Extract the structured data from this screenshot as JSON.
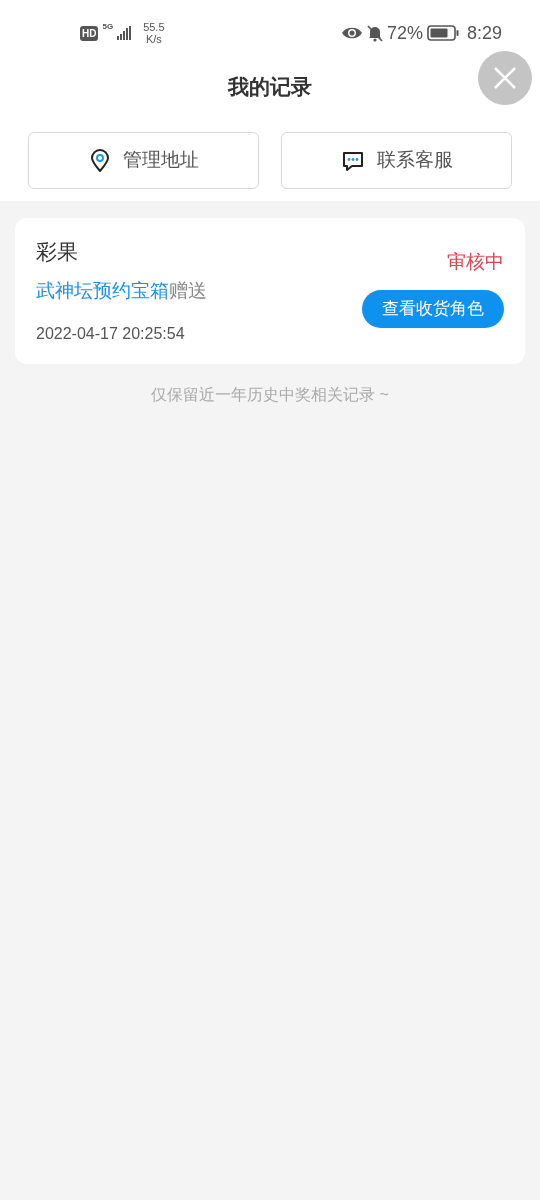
{
  "status_bar": {
    "hd": "HD",
    "network": "5G",
    "speed": "55.5",
    "speed_unit": "K/s",
    "battery": "72%",
    "time": "8:29"
  },
  "header": {
    "title": "我的记录"
  },
  "actions": [
    {
      "kind": "address",
      "label": "管理地址"
    },
    {
      "kind": "service",
      "label": "联系客服"
    }
  ],
  "records": [
    {
      "name": "彩果",
      "source_link": "武神坛预约宝箱",
      "source_suffix": "赠送",
      "time": "2022-04-17 20:25:54",
      "status": "审核中",
      "button": "查看收货角色"
    }
  ],
  "footer_note": "仅保留近一年历史中奖相关记录 ~"
}
